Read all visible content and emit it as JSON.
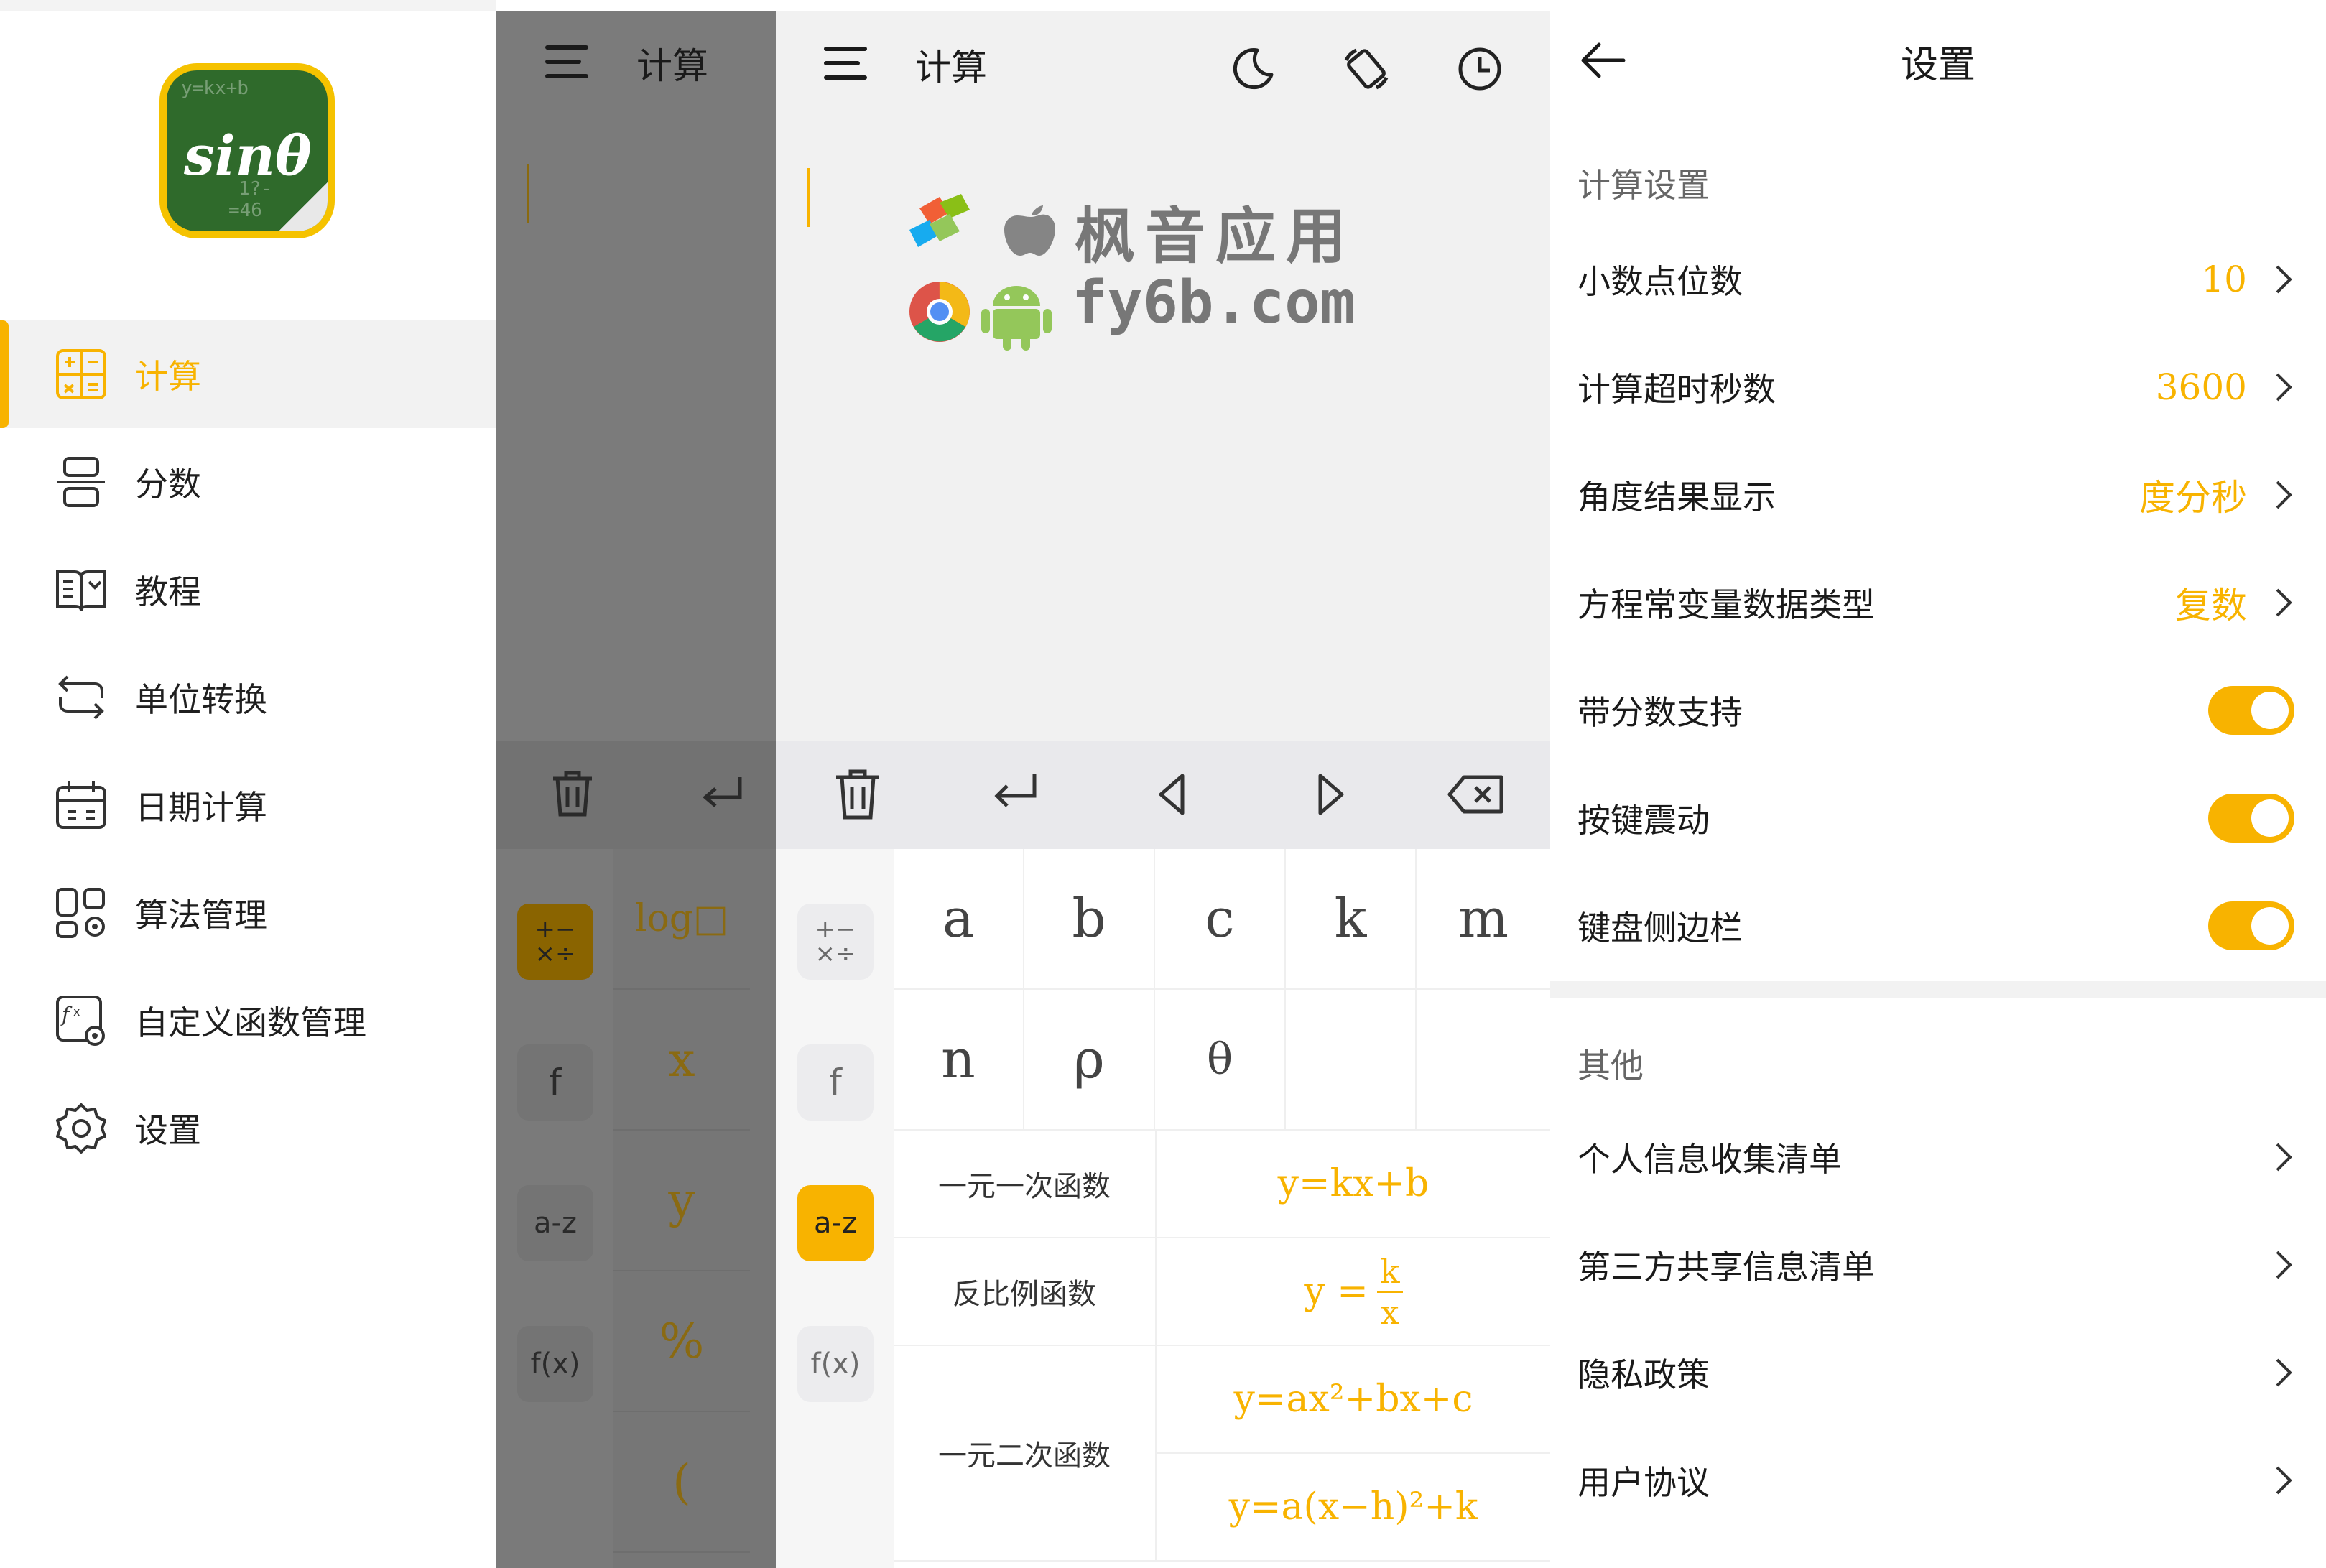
{
  "colors": {
    "accent": "#f8b300",
    "dim_overlay": "#7b7b7b",
    "background": "#ffffff"
  },
  "drawer": {
    "logo_text": "sinθ",
    "logo_chalk": [
      "y=kx+b",
      "1?-",
      "=46"
    ],
    "items": [
      {
        "label": "计算",
        "icon": "calculator-grid-icon",
        "active": true
      },
      {
        "label": "分数",
        "icon": "fraction-icon",
        "active": false
      },
      {
        "label": "教程",
        "icon": "book-icon",
        "active": false
      },
      {
        "label": "单位转换",
        "icon": "convert-arrows-icon",
        "active": false
      },
      {
        "label": "日期计算",
        "icon": "calendar-icon",
        "active": false
      },
      {
        "label": "算法管理",
        "icon": "algorithm-grid-icon",
        "active": false
      },
      {
        "label": "自定义函数管理",
        "icon": "custom-function-icon",
        "active": false
      },
      {
        "label": "设置",
        "icon": "gear-icon",
        "active": false
      }
    ]
  },
  "dim_calc": {
    "title": "计算",
    "side_buttons": [
      "+−\n×÷",
      "f",
      "a-z",
      "f(x)"
    ],
    "keys": [
      "log□",
      "x",
      "y",
      "%",
      "("
    ]
  },
  "calc": {
    "title": "计算",
    "header_icons": [
      "theme-moon-icon",
      "rotate-screen-icon",
      "history-clock-icon"
    ],
    "toolbar_icons": [
      "trash-icon",
      "enter-icon",
      "cursor-left-icon",
      "cursor-right-icon",
      "backspace-icon"
    ],
    "side_buttons": [
      "+−\n×÷",
      "f",
      "a-z",
      "f(x)"
    ],
    "selected_side": "a-z",
    "variables": [
      "a",
      "b",
      "c",
      "k",
      "m",
      "n",
      "ρ",
      "θ",
      "",
      ""
    ],
    "functions": [
      {
        "name": "一元一次函数",
        "formulas": [
          "y=kx+b"
        ]
      },
      {
        "name": "反比例函数",
        "formulas": [
          "y=k/x"
        ]
      },
      {
        "name": "一元二次函数",
        "formulas": [
          "y=ax²+bx+c",
          "y=a(x−h)²+k"
        ]
      }
    ],
    "inverse_formula": {
      "lhs": "y =",
      "numerator": "k",
      "denominator": "x"
    },
    "watermark": {
      "line1": "枫音应用",
      "line2": "fy6b.com"
    }
  },
  "settings": {
    "title": "设置",
    "section1_title": "计算设置",
    "rows1": [
      {
        "label": "小数点位数",
        "value": "10",
        "type": "link"
      },
      {
        "label": "计算超时秒数",
        "value": "3600",
        "type": "link"
      },
      {
        "label": "角度结果显示",
        "value": "度分秒",
        "type": "link"
      },
      {
        "label": "方程常变量数据类型",
        "value": "复数",
        "type": "link"
      },
      {
        "label": "带分数支持",
        "on": true,
        "type": "toggle"
      },
      {
        "label": "按键震动",
        "on": true,
        "type": "toggle"
      },
      {
        "label": "键盘侧边栏",
        "on": true,
        "type": "toggle"
      }
    ],
    "section2_title": "其他",
    "rows2": [
      {
        "label": "个人信息收集清单",
        "type": "link"
      },
      {
        "label": "第三方共享信息清单",
        "type": "link"
      },
      {
        "label": "隐私政策",
        "type": "link"
      },
      {
        "label": "用户协议",
        "type": "link"
      }
    ]
  }
}
